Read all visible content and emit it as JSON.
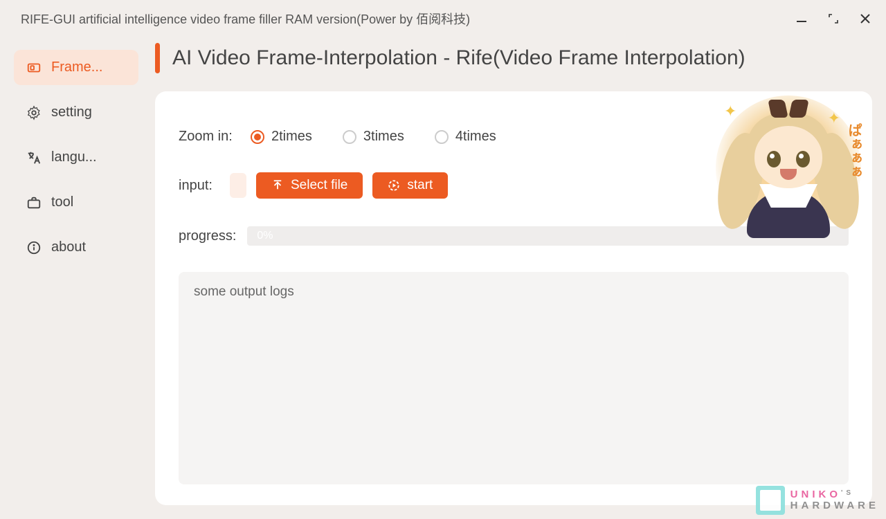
{
  "window": {
    "title": "RIFE-GUI artificial intelligence video frame filler RAM version(Power by 佰阅科技)"
  },
  "sidebar": {
    "items": [
      {
        "label": "Frame...",
        "icon": "frame"
      },
      {
        "label": "setting",
        "icon": "gear"
      },
      {
        "label": "langu...",
        "icon": "translate"
      },
      {
        "label": "tool",
        "icon": "briefcase"
      },
      {
        "label": "about",
        "icon": "info"
      }
    ]
  },
  "page": {
    "title": "AI Video Frame-Interpolation - Rife(Video Frame Interpolation)"
  },
  "zoom": {
    "label": "Zoom in:",
    "options": [
      "2times",
      "3times",
      "4times"
    ],
    "selected": 0
  },
  "input": {
    "label": "input:",
    "value": "",
    "select_file": "Select file",
    "start": "start"
  },
  "progress": {
    "label": "progress:",
    "text": "0%"
  },
  "logs": {
    "text": "some output logs"
  },
  "mascot": {
    "speech": "ぱぁぁぁ"
  },
  "watermark": {
    "line1": "UNIKO",
    "apostrophe": "'S",
    "line2": "HARDWARE"
  }
}
